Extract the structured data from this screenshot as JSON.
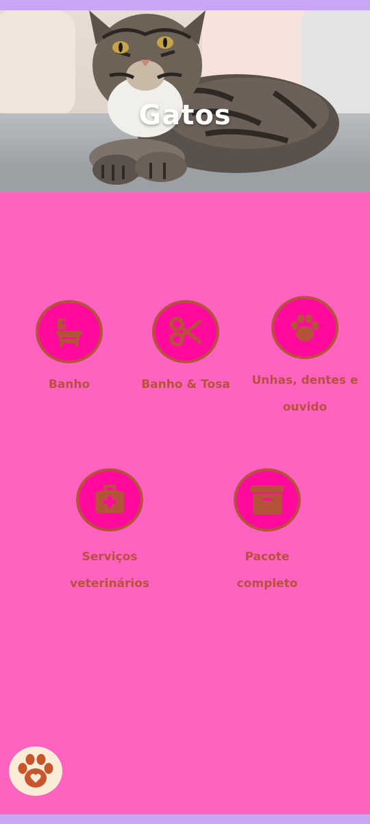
{
  "page": {
    "title": "Gatos"
  },
  "colors": {
    "background": "#ff62bf",
    "accent_bar": "#c8a5f5",
    "icon_circle": "#ff0a9c",
    "icon_brown": "#b5533a",
    "fab_background": "#fbecd8"
  },
  "hero": {
    "image": "tabby-cat-on-sofa-photo"
  },
  "services": [
    {
      "label": "Banho",
      "icon": "bathtub-icon"
    },
    {
      "label": "Banho & Tosa",
      "icon": "scissors-icon"
    },
    {
      "label": "Unhas, dentes e ouvido",
      "icon": "paw-icon"
    },
    {
      "label": "Serviços veterinários",
      "icon": "first-aid-kit-icon"
    },
    {
      "label": "Pacote completo",
      "icon": "archive-box-icon"
    }
  ],
  "fab": {
    "icon": "paw-heart-icon"
  }
}
